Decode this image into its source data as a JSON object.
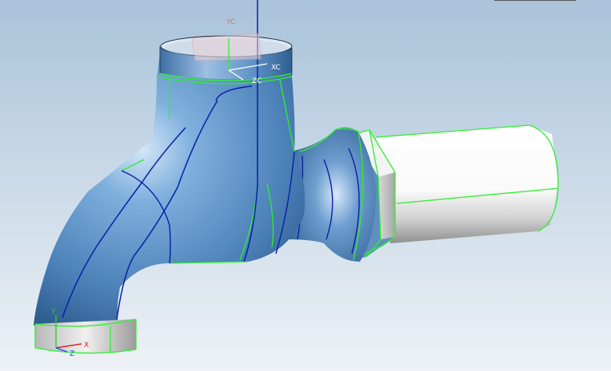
{
  "viewport": {
    "background_top": "#a9c3da",
    "background_bottom": "#eef2f6",
    "selection_color": "#2df02d",
    "isoline_color": "#0a1fa6",
    "body_color": "#5e93c6",
    "body_highlight": "#cfe2f4",
    "body_shadow": "#2f5f92",
    "cylinder_color": "#ffffff",
    "cylinder_shadow": "#bdbdbd"
  },
  "wcs": {
    "labels": {
      "xc": "XC",
      "yc": "YC",
      "zc": "ZC"
    },
    "colors": {
      "label": "#e07060",
      "label_zc": "#ffffff",
      "axis": "#0022cc"
    }
  },
  "absolute_triad": {
    "labels": {
      "x": "X",
      "y": "Y",
      "z": "Z"
    },
    "colors": {
      "x": "#e02020",
      "y": "#2ecc2e",
      "z": "#2040ff"
    }
  },
  "icons": {
    "wcs": "wcs-triad-icon",
    "absolute": "absolute-coordinate-triad-icon"
  }
}
